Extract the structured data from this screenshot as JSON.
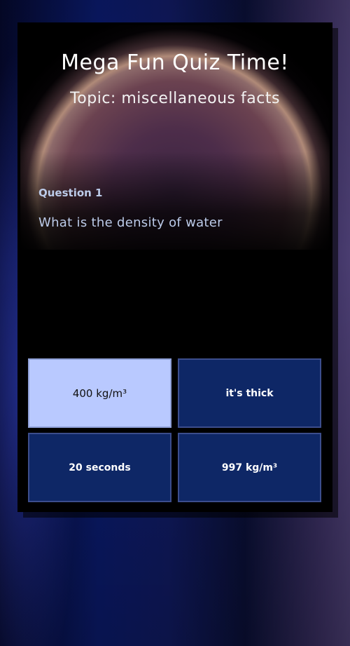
{
  "quiz": {
    "title": "Mega Fun Quiz Time!",
    "topic": "Topic:  miscellaneous facts",
    "question_label": "Question 1",
    "question_text": "What is the density of water"
  },
  "answers": [
    {
      "label": "400 kg/m³",
      "selected": true
    },
    {
      "label": "it's thick",
      "selected": false
    },
    {
      "label": "20 seconds",
      "selected": false
    },
    {
      "label": "997 kg/m³",
      "selected": false
    }
  ],
  "colors": {
    "answer_default": "#0e2766",
    "answer_selected": "#b9c9ff",
    "question_text": "#bccbe9"
  }
}
